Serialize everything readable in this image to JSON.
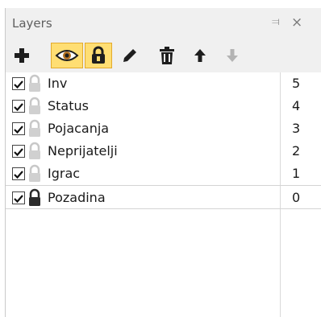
{
  "panel": {
    "title": "Layers",
    "pin_glyph": "⫤",
    "close_glyph": "×"
  },
  "toolbar": {
    "buttons": [
      {
        "icon": "add-layer-icon",
        "active": false
      },
      {
        "icon": "eye-icon",
        "active": true
      },
      {
        "icon": "lock-icon",
        "active": true
      },
      {
        "icon": "pencil-icon",
        "active": false
      },
      {
        "icon": "trash-icon",
        "active": false
      },
      {
        "icon": "arrow-up-icon",
        "active": false
      },
      {
        "icon": "arrow-down-icon",
        "active": false,
        "disabled": true
      }
    ]
  },
  "layers": [
    {
      "name": "Inv",
      "index": "5",
      "visible": true,
      "locked": false,
      "selected": false
    },
    {
      "name": "Status",
      "index": "4",
      "visible": true,
      "locked": false,
      "selected": false
    },
    {
      "name": "Pojacanja",
      "index": "3",
      "visible": true,
      "locked": false,
      "selected": false
    },
    {
      "name": "Neprijatelji",
      "index": "2",
      "visible": true,
      "locked": false,
      "selected": false
    },
    {
      "name": "Igrac",
      "index": "1",
      "visible": true,
      "locked": false,
      "selected": false
    },
    {
      "name": "Pozadina",
      "index": "0",
      "visible": true,
      "locked": true,
      "selected": true
    }
  ],
  "colors": {
    "accent": "#ffde73",
    "accent_border": "#e3aa2c",
    "header_bg": "#f0f0f0",
    "lock_unlocked": "#c8c8c8",
    "lock_locked": "#2a2a2a"
  }
}
